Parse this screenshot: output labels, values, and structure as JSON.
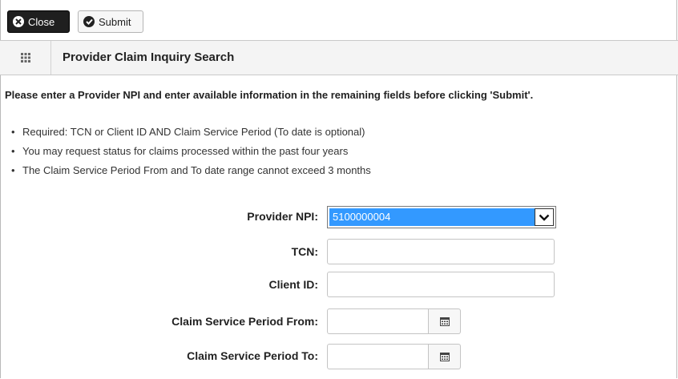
{
  "toolbar": {
    "close_label": "Close",
    "submit_label": "Submit"
  },
  "header": {
    "title": "Provider Claim Inquiry Search"
  },
  "instruction": "Please enter a Provider NPI and enter available information in the remaining fields before clicking 'Submit'.",
  "bullets": [
    "Required: TCN or Client ID AND Claim Service Period (To date is optional)",
    "You may request status for claims processed within the past four years",
    "The Claim Service Period From and To date range cannot exceed 3 months"
  ],
  "form": {
    "provider_npi": {
      "label": "Provider NPI:",
      "value": "5100000004"
    },
    "tcn": {
      "label": "TCN:",
      "value": ""
    },
    "client_id": {
      "label": "Client ID:",
      "value": ""
    },
    "service_from": {
      "label": "Claim Service Period From:",
      "value": ""
    },
    "service_to": {
      "label": "Claim Service Period To:",
      "value": ""
    }
  },
  "colors": {
    "selected_highlight": "#3399ff",
    "close_button_bg": "#1f1f1f"
  }
}
